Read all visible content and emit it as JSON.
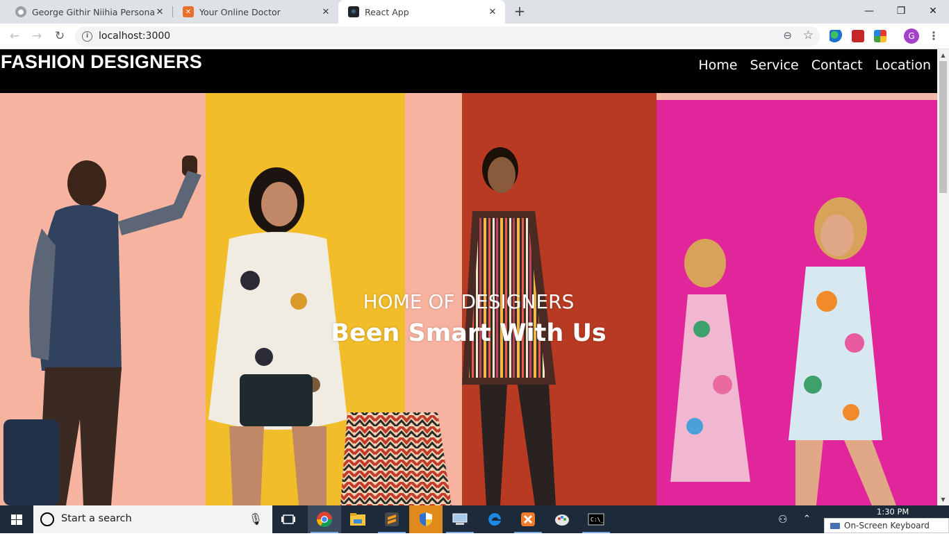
{
  "browser": {
    "tabs": [
      {
        "title": "George Githir Niihia Personal We",
        "active": false
      },
      {
        "title": "Your Online Doctor",
        "active": false
      },
      {
        "title": "React App",
        "active": true
      }
    ],
    "new_tab_label": "+",
    "url": "localhost:3000",
    "profile_initial": "G"
  },
  "site": {
    "brand": "FASHION DESIGNERS",
    "nav": [
      "Home",
      "Service",
      "Contact",
      "Location"
    ],
    "hero": {
      "subtitle": "HOME OF DESIGNERS",
      "title": "Been Smart With Us"
    },
    "colors": {
      "nav_bg": "#000000",
      "peach": "#f6b4a0",
      "yellow": "#f2bd2a",
      "red": "#b83a22",
      "magenta": "#e0269a"
    }
  },
  "taskbar": {
    "search_placeholder": "Start a search",
    "clock": "1:30 PM",
    "osk_label": "On-Screen Keyboard",
    "apps": [
      "task-view-icon",
      "chrome-icon",
      "file-explorer-icon",
      "sublime-text-icon",
      "security-shield-icon",
      "network-icon",
      "edge-icon",
      "xampp-icon",
      "paint-icon",
      "cmd-icon"
    ]
  }
}
